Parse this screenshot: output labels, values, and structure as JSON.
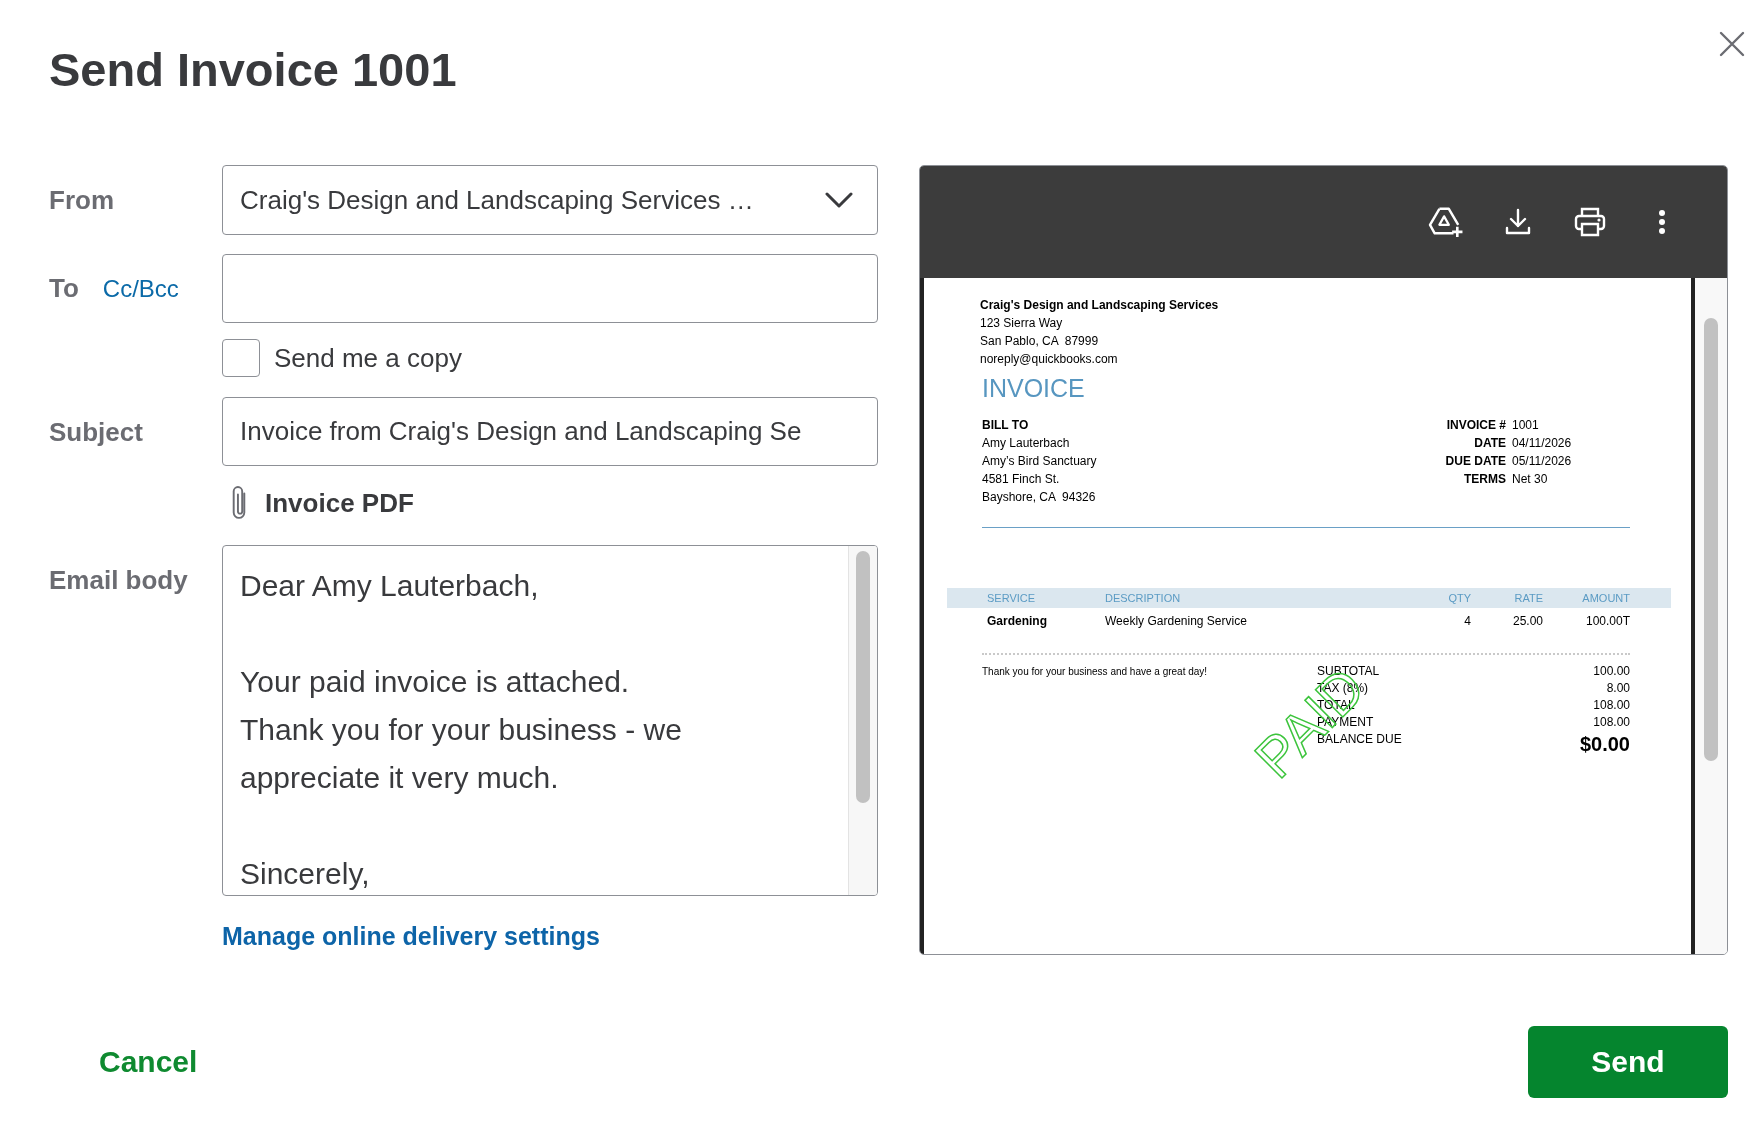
{
  "dialog": {
    "title": "Send Invoice 1001"
  },
  "form": {
    "from": {
      "label": "From",
      "value": "Craig's Design and Landscaping Services …"
    },
    "to": {
      "label": "To",
      "link": "Cc/Bcc"
    },
    "send_copy": {
      "label": "Send me a copy",
      "checked": false
    },
    "subject": {
      "label": "Subject",
      "value": "Invoice from Craig's Design and Landscaping Se"
    },
    "attachment": {
      "label": "Invoice PDF"
    },
    "email_body": {
      "label": "Email body",
      "paragraphs": [
        "Dear Amy Lauterbach,",
        "Your paid invoice is attached.\nThank you for your business - we appreciate it very much.",
        "Sincerely,"
      ]
    },
    "delivery_settings_link": "Manage online delivery settings"
  },
  "preview": {
    "company": {
      "name": "Craig's Design and Landscaping Services",
      "lines": [
        "123 Sierra Way",
        "San Pablo, CA  87999",
        "noreply@quickbooks.com"
      ]
    },
    "heading": "INVOICE",
    "bill_to": {
      "label": "BILL TO",
      "lines": [
        "Amy Lauterbach",
        "Amy’s Bird Sanctuary",
        "4581 Finch St.",
        "Bayshore, CA  94326"
      ]
    },
    "meta": [
      {
        "label": "INVOICE #",
        "value": "1001"
      },
      {
        "label": "DATE",
        "value": "04/11/2026"
      },
      {
        "label": "DUE DATE",
        "value": "05/11/2026"
      },
      {
        "label": "TERMS",
        "value": "Net 30"
      }
    ],
    "table": {
      "columns": [
        "SERVICE",
        "DESCRIPTION",
        "QTY",
        "RATE",
        "AMOUNT"
      ],
      "rows": [
        {
          "cells": [
            "Gardening",
            "Weekly Gardening Service",
            "4",
            "25.00",
            "100.00T"
          ]
        }
      ]
    },
    "message": "Thank you for your business and have a great day!",
    "totals": [
      {
        "kind": "line",
        "label": "SUBTOTAL",
        "value": "100.00"
      },
      {
        "kind": "line",
        "label": "TAX (8%)",
        "value": "8.00"
      },
      {
        "kind": "line",
        "label": "TOTAL",
        "value": "108.00"
      },
      {
        "kind": "line",
        "label": "PAYMENT",
        "value": "108.00"
      },
      {
        "kind": "balance",
        "label": "BALANCE DUE",
        "value": "$0.00"
      }
    ],
    "stamp": "PAID"
  },
  "footer": {
    "buttons": [
      {
        "kind": "secondary",
        "label": "Cancel"
      },
      {
        "kind": "primary",
        "label": "Send"
      }
    ]
  }
}
